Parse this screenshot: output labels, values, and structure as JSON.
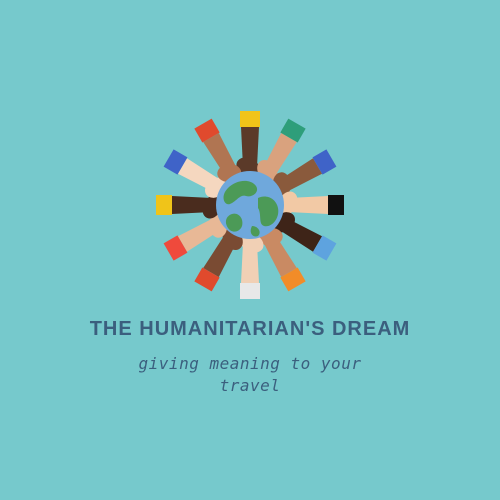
{
  "background": "#76c9cc",
  "text_color": "#3b5f7e",
  "logo": {
    "icon": "globe-icon",
    "globe_ocean": "#6fa8dc",
    "globe_land": "#4c9a57",
    "hands_icon": "hands-circle-icon",
    "sleeve_colors": [
      "#f0c419",
      "#2e9e7a",
      "#3f63c8",
      "#111111",
      "#5ea3df",
      "#f28c28",
      "#e8e8e8",
      "#e04a2d",
      "#ef4a3c",
      "#f0c419",
      "#3f63c8",
      "#e04a2d"
    ],
    "skin_tones": [
      "#5b3a29",
      "#d9a27e",
      "#8a5a3c",
      "#f2c9a5",
      "#3e2418",
      "#c98a63",
      "#f1d0b5",
      "#7a4b33",
      "#e8b896",
      "#4a2c1e",
      "#f5d7bf",
      "#b07552"
    ]
  },
  "title": "THE HUMANITARIAN'S DREAM",
  "tagline_line1": "giving meaning to your",
  "tagline_line2": "travel"
}
